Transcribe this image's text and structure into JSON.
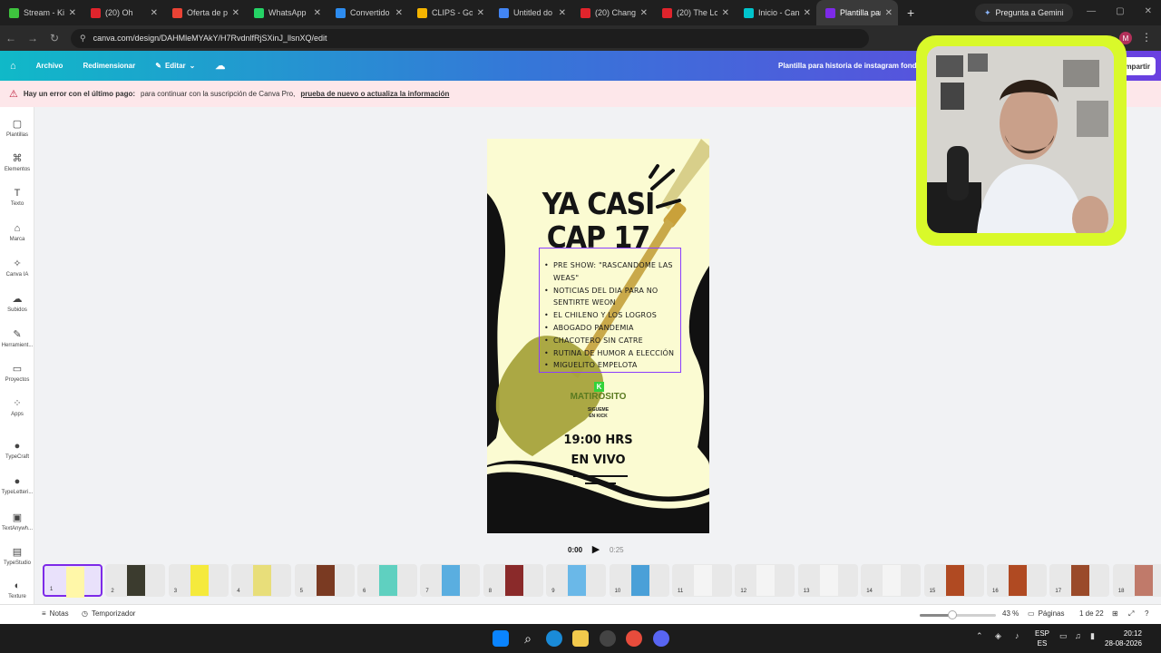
{
  "browser": {
    "tabs": [
      {
        "label": "Stream - Ki",
        "color": "#3ec33e",
        "active": false
      },
      {
        "label": "(20) Oh",
        "color": "#e0242c",
        "active": false
      },
      {
        "label": "Oferta de p",
        "color": "#ea4335",
        "active": false
      },
      {
        "label": "WhatsApp",
        "color": "#25d366",
        "active": false
      },
      {
        "label": "Convertido",
        "color": "#2d8cf0",
        "active": false
      },
      {
        "label": "CLIPS - Goo",
        "color": "#f4b400",
        "active": false
      },
      {
        "label": "Untitled do",
        "color": "#4285f4",
        "active": false
      },
      {
        "label": "(20) Chang",
        "color": "#e0242c",
        "active": false
      },
      {
        "label": "(20) The Lo",
        "color": "#e0242c",
        "active": false
      },
      {
        "label": "Inicio - Can",
        "color": "#00c4cc",
        "active": false
      },
      {
        "label": "Plantilla par",
        "color": "#7d2ae8",
        "active": true
      }
    ],
    "gemini_label": "Pregunta a Gemini",
    "url": "canva.com/design/DAHMleMYAkY/H7RvdnlfRjSXinJ_llsnXQ/edit",
    "profile_initial": "M"
  },
  "canva_bar": {
    "archivo": "Archivo",
    "redimensionar": "Redimensionar",
    "editar": "Editar",
    "doc_title": "Plantilla para historia de instagram fondo",
    "share": "mpartir"
  },
  "banner": {
    "bold": "Hay un error con el último pago:",
    "text": "para continuar con la suscripción de Canva Pro,",
    "link": "prueba de nuevo o actualiza la información"
  },
  "sidebar": {
    "items": [
      {
        "label": "Plantillas",
        "icon": "▢"
      },
      {
        "label": "Elementos",
        "icon": "⌘"
      },
      {
        "label": "Texto",
        "icon": "T"
      },
      {
        "label": "Marca",
        "icon": "⌂"
      },
      {
        "label": "Canva IA",
        "icon": "✧"
      },
      {
        "label": "Subidos",
        "icon": "☁"
      },
      {
        "label": "Herramient...",
        "icon": "✎"
      },
      {
        "label": "Proyectos",
        "icon": "▭"
      },
      {
        "label": "Apps",
        "icon": "⁘"
      },
      {
        "label": "TypeCraft",
        "icon": "●"
      },
      {
        "label": "TypeLetteri...",
        "icon": "●"
      },
      {
        "label": "TextAnywh...",
        "icon": "▣"
      },
      {
        "label": "TypeStudio",
        "icon": "▤"
      },
      {
        "label": "Texture",
        "icon": "◐"
      }
    ]
  },
  "design": {
    "title_line1": "YA CASI",
    "title_line2": "CAP 17",
    "agenda": [
      "PRE SHOW: \"RASCANDOME LAS",
      "WEAS\"",
      "NOTICIAS DEL DIA PARA NO",
      "SENTIRTE WEON",
      "EL CHILENO Y LOS LOGROS",
      "ABOGADO PANDEMIA",
      "CHACOTERO SIN CATRE",
      "RUTINA DE HUMOR A ELECCIÓN",
      "MIGUELITO EMPELOTA"
    ],
    "agenda_bulleted": [
      true,
      false,
      true,
      false,
      true,
      true,
      true,
      true,
      true
    ],
    "brand": "MATIROSITO",
    "brand_sub_1": "SIGUEME",
    "brand_sub_2": "EN KICK",
    "time": "19:00 HRS",
    "live": "EN VIVO",
    "colors": {
      "background": "#fbfbd2",
      "black": "#111111",
      "shovel": "#a6a33c"
    }
  },
  "playback": {
    "current": "0:00",
    "duration": "0:25"
  },
  "thumbnails": {
    "pages": [
      "1",
      "2",
      "3",
      "4",
      "5",
      "6",
      "7",
      "8",
      "9",
      "10",
      "11",
      "12",
      "13",
      "14",
      "15",
      "16",
      "17",
      "18"
    ],
    "selected": "1",
    "colors": [
      "#fff7a8",
      "#3b3b2e",
      "#f5ea3c",
      "#e8de7a",
      "#7a3a22",
      "#5fd0c0",
      "#5aaee0",
      "#8a2a2a",
      "#6ab8e8",
      "#4aa0d8",
      "#f4f4f4",
      "#f4f4f4",
      "#f4f4f4",
      "#f4f4f4",
      "#b04a22",
      "#b04a22",
      "#9a4a2a",
      "#c07a6a"
    ]
  },
  "bottombar": {
    "notas": "Notas",
    "temporizador": "Temporizador",
    "zoom": "43 %",
    "zoom_fraction": 0.43,
    "paginas": "Páginas",
    "page_count": "1 de 22"
  },
  "taskbar": {
    "lang_1": "ESP",
    "lang_2": "ES",
    "time": "20:12",
    "date": "28-08-2026"
  }
}
